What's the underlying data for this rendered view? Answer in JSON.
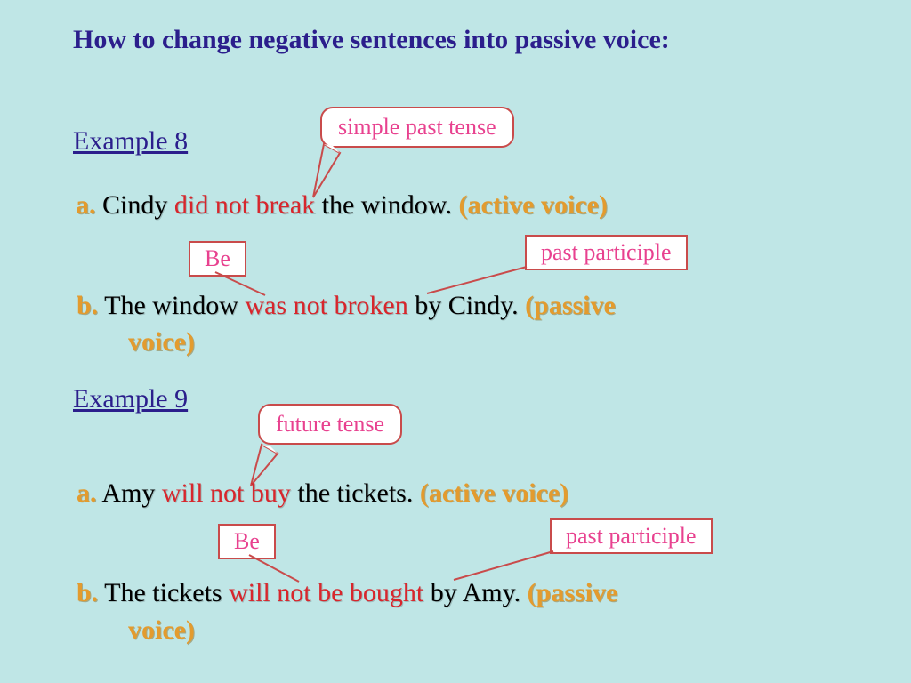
{
  "title": "How to change negative sentences into passive voice:",
  "example8": {
    "label": "Example 8",
    "tense_callout": "simple past tense",
    "a": {
      "bullet": "a.",
      "pre": "  Cindy ",
      "verb": "did not break",
      "post": " the window.   ",
      "voice": "(active voice)"
    },
    "be_box": "Be",
    "pp_box": "past participle",
    "b": {
      "bullet": "b.",
      "pre": "  The window ",
      "verb": "was not broken",
      "post": " by Cindy.  ",
      "voice": "(passive",
      "voice2": "voice)"
    }
  },
  "example9": {
    "label": "Example 9",
    "tense_callout": "future tense",
    "a": {
      "bullet": "a.",
      "pre": "  Amy ",
      "verb": "will not buy",
      "post": " the tickets.   ",
      "voice": "(active voice)"
    },
    "be_box": "Be",
    "pp_box": "past participle",
    "b": {
      "bullet": "b.",
      "pre": " The tickets ",
      "verb": "will not be bought",
      "post": " by Amy.  ",
      "voice": "(passive",
      "voice2": "voice)"
    }
  }
}
